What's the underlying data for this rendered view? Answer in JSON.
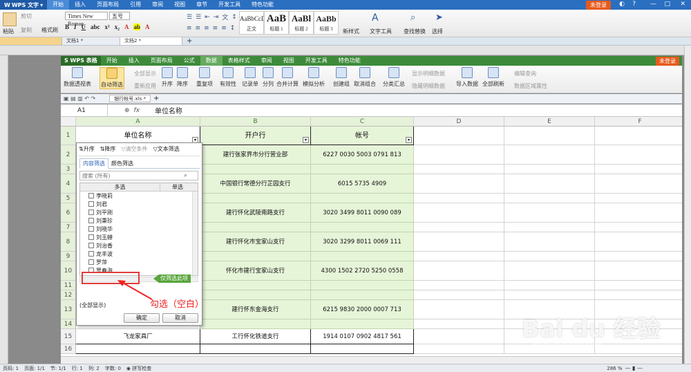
{
  "writer": {
    "app_name": "WPS 文字",
    "menu": [
      "开始",
      "插入",
      "页面布局",
      "引用",
      "审阅",
      "视图",
      "章节",
      "开发工具",
      "特色功能"
    ],
    "login": "未登录",
    "font_name": "Times New Roman",
    "font_size": "五号",
    "paste": "粘贴",
    "cut": "剪切",
    "copy": "复制",
    "format_painter": "格式刷",
    "styles": [
      {
        "preview": "AaBbCcDd",
        "label": "正文"
      },
      {
        "preview": "AaB",
        "label": "标题 1"
      },
      {
        "preview": "AaBl",
        "label": "标题 2"
      },
      {
        "preview": "AaBb",
        "label": "标题 3"
      }
    ],
    "new_style": "新样式",
    "text_tools": "文字工具",
    "find_replace": "查找替换",
    "select": "选择",
    "tabs": [
      "文档1 *",
      "文档2 *"
    ]
  },
  "et": {
    "logo": "S WPS 表格",
    "menu": [
      "开始",
      "插入",
      "页面布局",
      "公式",
      "数据",
      "表格样式",
      "审阅",
      "视图",
      "开发工具",
      "特色功能"
    ],
    "active_menu": "数据",
    "login": "未登录",
    "ribbon": {
      "pivot": "数据透视表",
      "autofilter": "自动筛选",
      "show_all": "全部显示",
      "reapply": "重新应用",
      "asc": "升序",
      "desc": "降序",
      "duplicates": "重复项",
      "validity": "有效性",
      "record": "记录单",
      "split": "分列",
      "consolidate": "合并计算",
      "whatif": "模拟分析",
      "group": "创建组",
      "ungroup": "取消组合",
      "subtotal": "分类汇总",
      "show_detail": "显示明细数据",
      "hide_detail": "隐藏明细数据",
      "import": "导入数据",
      "refresh_all": "全部刷新",
      "edit_query": "编辑查询",
      "range_props": "数据区域属性"
    },
    "file_tab": "银行帐号.xls *",
    "cell_ref": "A1",
    "fx": "fx",
    "formula": "单位名称",
    "columns": [
      "A",
      "B",
      "C",
      "D",
      "E",
      "F"
    ],
    "rows": [
      {
        "n": "1",
        "a": "单位名称",
        "b": "开户行",
        "c": "帐号"
      },
      {
        "n": "2",
        "a": "",
        "b": "建行张家界市分行营业部",
        "c": "6227 0030 5003 0791 813"
      },
      {
        "n": "3",
        "a": "",
        "b": "",
        "c": ""
      },
      {
        "n": "4",
        "a": "",
        "b": "中国银行常德分行芷园支行",
        "c": "6015 5735 4909"
      },
      {
        "n": "5",
        "a": "",
        "b": "",
        "c": ""
      },
      {
        "n": "6",
        "a": "",
        "b": "建行怀化武陵南路支行",
        "c": "3020 3499 8011 0090 089"
      },
      {
        "n": "7",
        "a": "",
        "b": "",
        "c": ""
      },
      {
        "n": "8",
        "a": "",
        "b": "建行怀化市宝家山支行",
        "c": "3020 3299 8011 0069 111"
      },
      {
        "n": "9",
        "a": "",
        "b": "",
        "c": ""
      },
      {
        "n": "10",
        "a": "",
        "b": "怀化市建行宝家山支行",
        "c": "4300 1502 2720 5250 0558"
      },
      {
        "n": "11",
        "a": "",
        "b": "",
        "c": ""
      },
      {
        "n": "12",
        "a": "",
        "b": "",
        "c": ""
      },
      {
        "n": "13",
        "a": "",
        "b": "建行怀东金海支行",
        "c": "6215 9830 2000 0007 713"
      },
      {
        "n": "14",
        "a": "",
        "b": "",
        "c": ""
      },
      {
        "n": "15",
        "a": "飞龙家具厂",
        "b": "工行怀化铁道支行",
        "c": "1914 0107 0902 4817 561"
      },
      {
        "n": "16",
        "a": "",
        "b": "",
        "c": ""
      }
    ]
  },
  "filter_popup": {
    "sort_asc": "升序",
    "sort_desc": "降序",
    "clear": "清空条件",
    "text_filter": "文本筛选",
    "tab_content": "内容筛选",
    "tab_color": "颜色筛选",
    "search_placeholder": "搜索 (所有)",
    "col_multi": "多选",
    "col_single": "单选",
    "items": [
      {
        "label": "李晓莉",
        "checked": false
      },
      {
        "label": "刘君",
        "checked": false
      },
      {
        "label": "刘平刚",
        "checked": false
      },
      {
        "label": "刘秉珍",
        "checked": false
      },
      {
        "label": "刘晓华",
        "checked": false
      },
      {
        "label": "刘玉蝉",
        "checked": false
      },
      {
        "label": "刘治香",
        "checked": false
      },
      {
        "label": "龙丰波",
        "checked": false
      },
      {
        "label": "罗萍",
        "checked": false
      },
      {
        "label": "罗春海",
        "checked": false
      },
      {
        "label": "(空白)",
        "checked": true
      }
    ],
    "only_this": "仅筛选此项",
    "show_all": "(全部显示)",
    "ok": "确定",
    "cancel": "取消"
  },
  "annotation": "勾选（空白）",
  "status": {
    "page": "页码: 1",
    "pages": "页面: 1/1",
    "section": "节: 1/1",
    "line": "行: 1",
    "col": "列: 2",
    "words": "字数: 0",
    "spell": "拼写检查",
    "zoom": "286 %"
  },
  "watermark": {
    "main": "Bai du 经验",
    "sub": "jingyan.baidu.com"
  }
}
